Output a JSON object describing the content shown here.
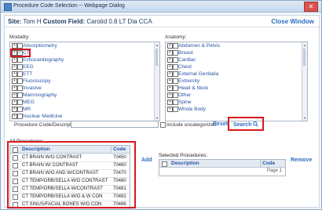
{
  "window": {
    "title": "Procedure Code Selection -- Webpage Dialog",
    "close_glyph": "✕"
  },
  "header": {
    "site_label": "Site:",
    "site_value": "Tom H",
    "custom_field_label": "Custom Field:",
    "custom_field_value": "Carotid 0.8 LT Dia CCA",
    "close_window": "Close Window"
  },
  "modality": {
    "label": "Modality:",
    "items": [
      {
        "label": "Absorptiometry",
        "checked": false
      },
      {
        "label": "CT",
        "checked": true
      },
      {
        "label": "Echocardiography",
        "checked": false
      },
      {
        "label": "EEG",
        "checked": false
      },
      {
        "label": "ETT",
        "checked": false
      },
      {
        "label": "Fluoroscopy",
        "checked": false
      },
      {
        "label": "Invasive",
        "checked": false
      },
      {
        "label": "Mammography",
        "checked": false
      },
      {
        "label": "MEG",
        "checked": false
      },
      {
        "label": "MR",
        "checked": false
      },
      {
        "label": "Nuclear Medicine",
        "checked": false
      }
    ]
  },
  "anatomy": {
    "label": "Anatomy:",
    "items": [
      {
        "label": "Abdomen & Pelvis"
      },
      {
        "label": "Breast"
      },
      {
        "label": "Cardiac"
      },
      {
        "label": "Chest"
      },
      {
        "label": "External Genitalia"
      },
      {
        "label": "Extremity"
      },
      {
        "label": "Head & Neck"
      },
      {
        "label": "Other"
      },
      {
        "label": "Spine"
      },
      {
        "label": "Whole Body"
      }
    ]
  },
  "search": {
    "label": "Procedure Code/Description",
    "value": "",
    "include_uncategorized": "Include uncategorized",
    "reset": "Reset",
    "search": "Search"
  },
  "all_procedures": {
    "label": "All Procedures:",
    "col_description": "Description",
    "col_code": "Code",
    "rows": [
      {
        "description": "CT BRAIN W/O CONTRAST",
        "code": "70450"
      },
      {
        "description": "CT BRAIN W/ CONTRAST",
        "code": "70460"
      },
      {
        "description": "CT BRAIN W/O AND W/CONTRAST",
        "code": "70470"
      },
      {
        "description": "CT TEMP/ORB/SELLA W/O CONTRAST",
        "code": "70480"
      },
      {
        "description": "CT TEMP/ORB/SELLA W/CONTRAST",
        "code": "70481"
      },
      {
        "description": "CT TEMP/ORB/SELLA W/O & W CON",
        "code": "70482"
      },
      {
        "description": "CT SINUS/FACIAL BONES W/O CON",
        "code": "70486"
      }
    ]
  },
  "actions": {
    "add": "Add",
    "remove": "Remove"
  },
  "selected_procedures": {
    "label": "Selected Procedures:",
    "col_description": "Description",
    "col_code": "Code",
    "pager": "Page 1"
  }
}
